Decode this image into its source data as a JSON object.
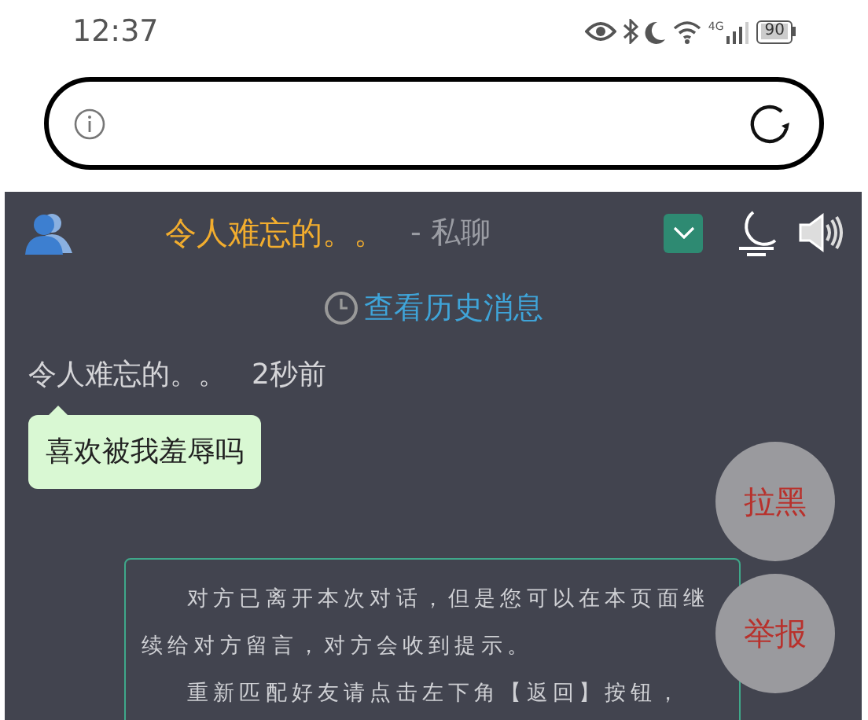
{
  "status_bar": {
    "time": "12:37",
    "network": "4G",
    "battery": "90"
  },
  "chat_header": {
    "peer_name": "令人难忘的。。",
    "mode": "- 私聊",
    "dropdown_open": false
  },
  "history_link": "查看历史消息",
  "messages": [
    {
      "sender": "令人难忘的。。",
      "time": "2秒前",
      "text": "喜欢被我羞辱吗"
    }
  ],
  "side_buttons": [
    "拉黑",
    "举报"
  ],
  "notice": {
    "paragraphs": [
      "对方已离开本次对话，但是您可以在本页面继续给对方留言，对方会收到提示。",
      "重新匹配好友请点击左下角【返回】按钮，"
    ]
  }
}
